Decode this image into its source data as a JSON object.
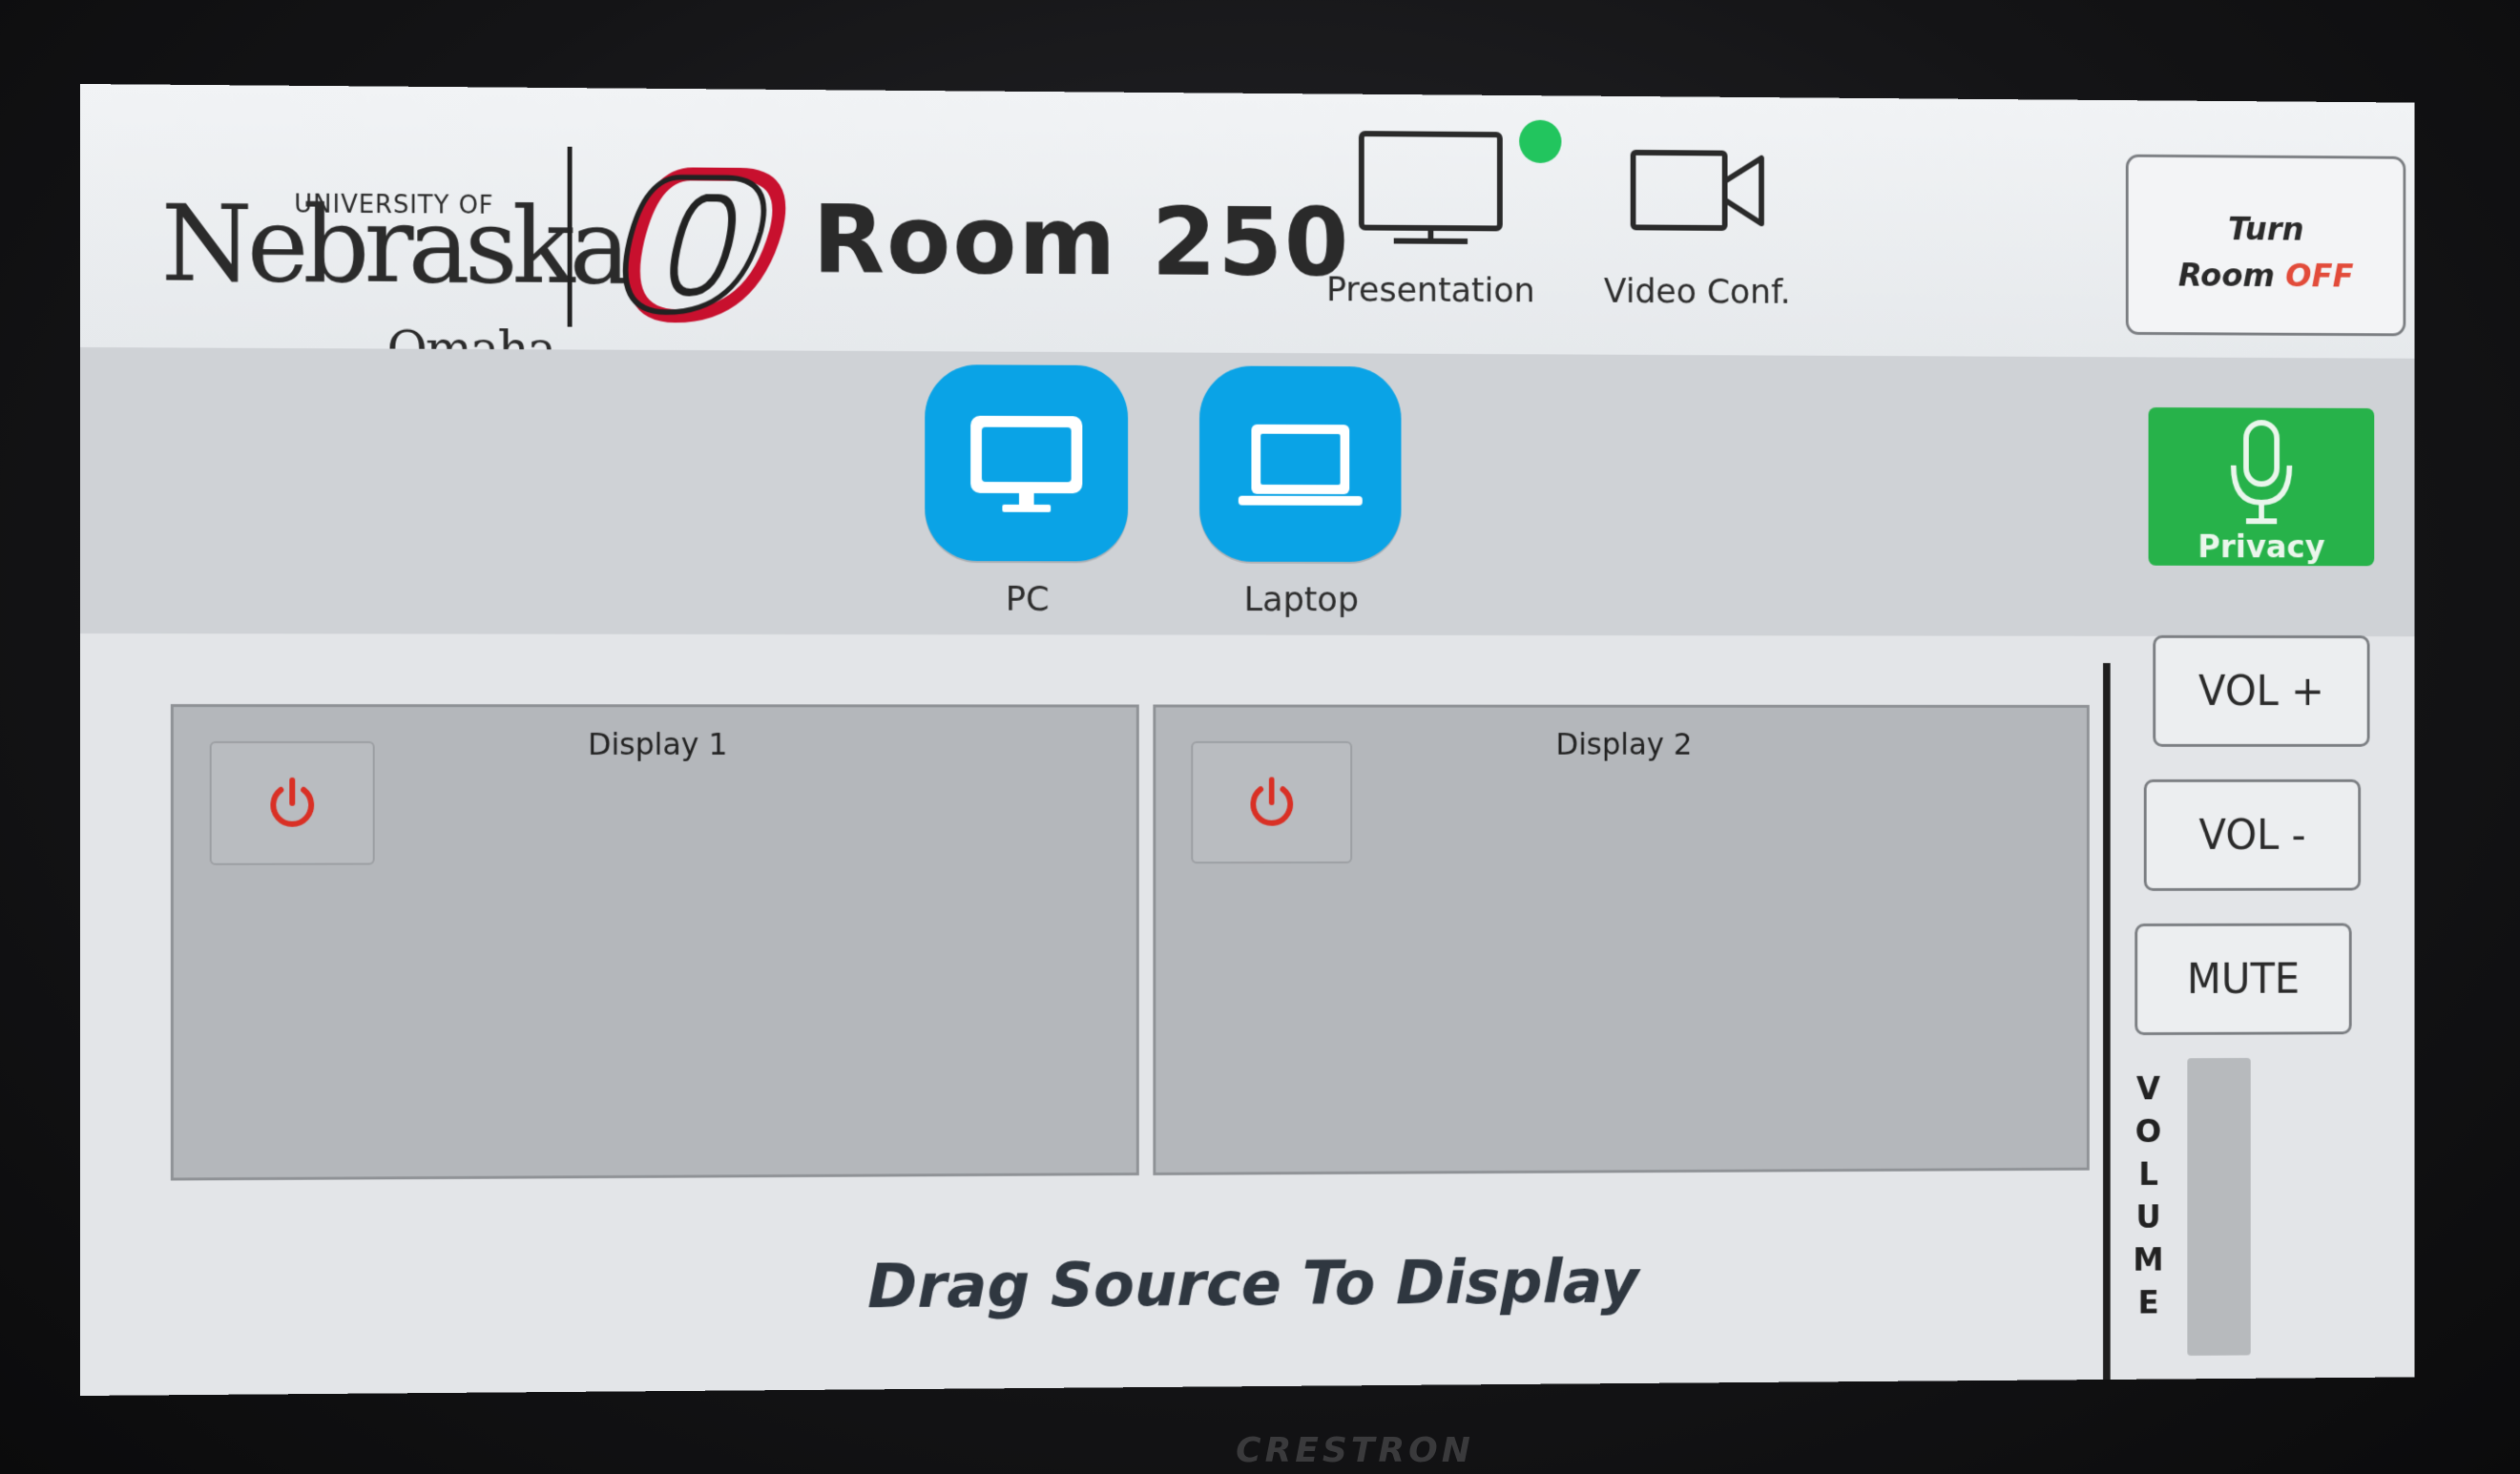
{
  "header": {
    "logo": {
      "university_text": "UNIVERSITY OF",
      "name_text": "Nebraska",
      "city_text": "Omaha"
    },
    "room_title": "Room 250",
    "modes": [
      {
        "label": "Presentation",
        "icon": "monitor-icon",
        "active": true
      },
      {
        "label": "Video Conf.",
        "icon": "video-camera-icon",
        "active": false
      }
    ],
    "turn_off": {
      "line1": "Turn",
      "line2_prefix": "Room ",
      "line2_emph": "OFF"
    }
  },
  "sources": [
    {
      "label": "PC",
      "icon": "desktop-monitor-icon"
    },
    {
      "label": "Laptop",
      "icon": "laptop-icon"
    }
  ],
  "privacy": {
    "label": "Privacy",
    "icon": "microphone-icon"
  },
  "displays": [
    {
      "title": "Display 1",
      "power_icon": "power-icon"
    },
    {
      "title": "Display 2",
      "power_icon": "power-icon"
    }
  ],
  "volume": {
    "plus_label": "VOL +",
    "minus_label": "VOL -",
    "mute_label": "MUTE",
    "vertical_label": [
      "V",
      "O",
      "L",
      "U",
      "M",
      "E"
    ],
    "level": 0
  },
  "instruction": "Drag Source To Display",
  "device_brand": "CRESTRON",
  "colors": {
    "source_tile": "#0aa3e6",
    "privacy_green": "#27b24a",
    "active_indicator": "#22c55e",
    "power_red": "#d93025",
    "off_red": "#e24b3a"
  }
}
